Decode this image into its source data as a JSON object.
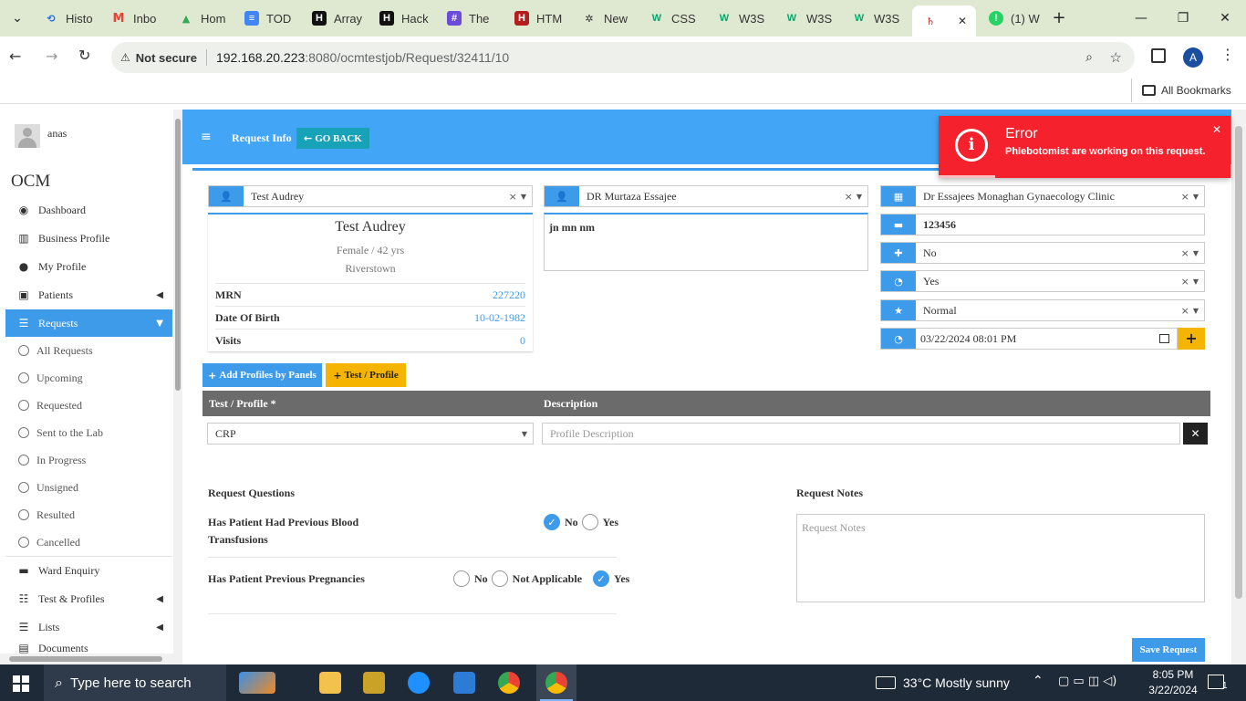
{
  "browser": {
    "tabs": [
      {
        "label": "Histo",
        "icon": "history-icon"
      },
      {
        "label": "Inbo",
        "icon": "gmail-icon"
      },
      {
        "label": "Hom",
        "icon": "drive-icon"
      },
      {
        "label": "TOD",
        "icon": "docs-icon"
      },
      {
        "label": "Array",
        "icon": "hackerrank-icon"
      },
      {
        "label": "Hack",
        "icon": "hackerrank-icon"
      },
      {
        "label": "The",
        "icon": "site-icon"
      },
      {
        "label": "HTM",
        "icon": "site-icon"
      },
      {
        "label": "New",
        "icon": "chatgpt-icon"
      },
      {
        "label": "CSS",
        "icon": "w3schools-icon"
      },
      {
        "label": "W3S",
        "icon": "w3schools-icon"
      },
      {
        "label": "W3S",
        "icon": "w3schools-icon"
      },
      {
        "label": "W3S",
        "icon": "w3schools-icon"
      },
      {
        "label": "",
        "icon": "app-icon"
      },
      {
        "label": "(1) W",
        "icon": "whatsapp-icon"
      }
    ],
    "security_label": "Not secure",
    "url_host": "192.168.20.223",
    "url_rest": ":8080/ocmtestjob/Request/32411/10",
    "bookmarks_label": "All Bookmarks",
    "profile_initial": "A"
  },
  "sidebar": {
    "user_name": "anas",
    "app_name": "OCM",
    "items": [
      {
        "label": "Dashboard",
        "icon": "dashboard-icon"
      },
      {
        "label": "Business Profile",
        "icon": "building-icon"
      },
      {
        "label": "My Profile",
        "icon": "user-icon"
      },
      {
        "label": "Patients",
        "icon": "patients-icon"
      },
      {
        "label": "Requests",
        "icon": "database-icon"
      }
    ],
    "sub_items": [
      "All Requests",
      "Upcoming",
      "Requested",
      "Sent to the Lab",
      "In Progress",
      "Unsigned",
      "Resulted",
      "Cancelled"
    ],
    "items_after": [
      {
        "label": "Ward Enquiry",
        "icon": "bed-icon"
      },
      {
        "label": "Test & Profiles",
        "icon": "flask-icon"
      },
      {
        "label": "Lists",
        "icon": "list-icon"
      },
      {
        "label": "Documents",
        "icon": "document-icon"
      }
    ]
  },
  "header": {
    "title": "Request Info",
    "go_back": "GO BACK"
  },
  "patient": {
    "select_value": "Test Audrey",
    "name": "Test Audrey",
    "gender_age": "Female / 42 yrs",
    "location": "Riverstown",
    "mrn_label": "MRN",
    "mrn": "227220",
    "dob_label": "Date Of Birth",
    "dob": "10-02-1982",
    "visits_label": "Visits",
    "visits": "0"
  },
  "doctor": {
    "select_value": "DR Murtaza Essajee",
    "notes": "jn mn nm"
  },
  "clinic": {
    "select_value": "Dr Essajees Monaghan Gynaecology Clinic",
    "bed": "123456",
    "option1": "No",
    "option2": "Yes",
    "priority": "Normal",
    "datetime": "03/22/2024 08:01 PM"
  },
  "actions": {
    "add_profiles": "Add Profiles by Panels",
    "test_profile": "Test / Profile"
  },
  "table": {
    "col1": "Test / Profile *",
    "col2": "Description",
    "row_test": "CRP",
    "row_desc_placeholder": "Profile Description"
  },
  "questions": {
    "title": "Request Questions",
    "q1": "Has Patient Had Previous Blood Transfusions",
    "q1_no": "No",
    "q1_yes": "Yes",
    "q1_selected": "No",
    "q2": "Has Patient Previous Pregnancies",
    "q2_no": "No",
    "q2_na": "Not Applicable",
    "q2_yes": "Yes",
    "q2_selected": "Yes"
  },
  "notes": {
    "title": "Request Notes",
    "placeholder": "Request Notes"
  },
  "save_label": "Save Request",
  "toast": {
    "title": "Error",
    "message": "Phlebotomist are working on this request."
  },
  "taskbar": {
    "search_placeholder": "Type here to search",
    "weather": "33°C  Mostly sunny",
    "time": "8:05 PM",
    "date": "3/22/2024",
    "notification_count": "1"
  },
  "colors": {
    "primary": "#42a5f5",
    "accent": "#3d9be9",
    "warning": "#f5b400",
    "error": "#f5222d",
    "table_header": "#6b6b6b"
  }
}
